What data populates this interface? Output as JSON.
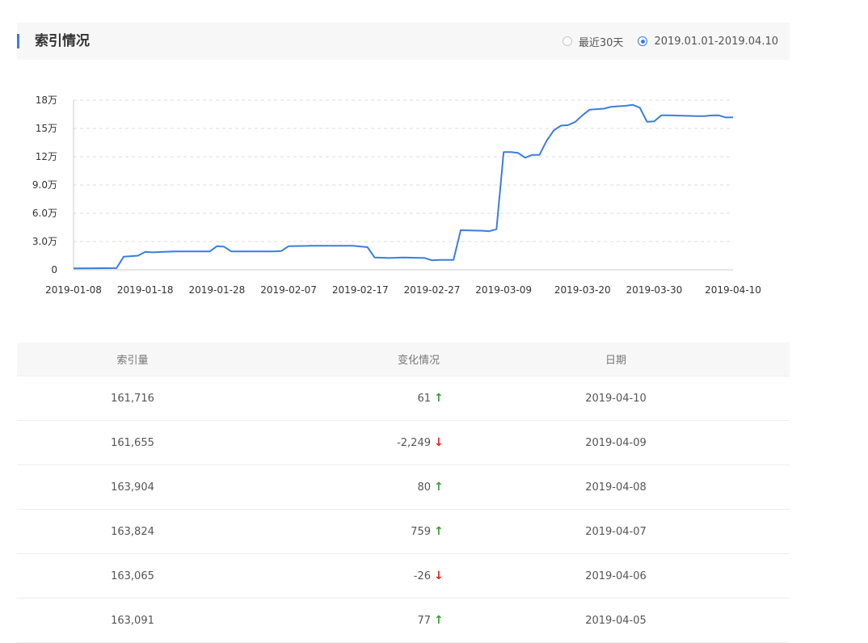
{
  "header": {
    "title": "索引情况",
    "options": [
      {
        "label": "最近30天",
        "selected": false
      },
      {
        "label": "2019.01.01-2019.04.10",
        "selected": true
      }
    ]
  },
  "colors": {
    "line": "#3b7ddd",
    "accent": "#3b7ddd",
    "up": "#3c9a3c",
    "down": "#e02020"
  },
  "chart_data": {
    "type": "line",
    "x_ticks": [
      "2019-01-08",
      "2019-01-18",
      "2019-01-28",
      "2019-02-07",
      "2019-02-17",
      "2019-02-27",
      "2019-03-09",
      "2019-03-20",
      "2019-03-30",
      "2019-04-10"
    ],
    "y_ticks": [
      "0",
      "3.0万",
      "6.0万",
      "9.0万",
      "12万",
      "15万",
      "18万"
    ],
    "ylim": [
      0,
      180000
    ],
    "xlim": [
      "2019-01-08",
      "2019-04-10"
    ],
    "grid": true,
    "points": [
      [
        "2019-01-08",
        1500
      ],
      [
        "2019-01-14",
        1800
      ],
      [
        "2019-01-15",
        14000
      ],
      [
        "2019-01-16",
        14500
      ],
      [
        "2019-01-17",
        15000
      ],
      [
        "2019-01-18",
        19000
      ],
      [
        "2019-01-19",
        18500
      ],
      [
        "2019-01-22",
        19500
      ],
      [
        "2019-01-24",
        19500
      ],
      [
        "2019-01-27",
        19500
      ],
      [
        "2019-01-28",
        25000
      ],
      [
        "2019-01-29",
        24500
      ],
      [
        "2019-01-30",
        19500
      ],
      [
        "2019-02-05",
        19500
      ],
      [
        "2019-02-06",
        20000
      ],
      [
        "2019-02-07",
        25000
      ],
      [
        "2019-02-10",
        25500
      ],
      [
        "2019-02-16",
        25500
      ],
      [
        "2019-02-18",
        24000
      ],
      [
        "2019-02-19",
        13000
      ],
      [
        "2019-02-21",
        12500
      ],
      [
        "2019-02-23",
        13000
      ],
      [
        "2019-02-26",
        12500
      ],
      [
        "2019-02-27",
        10000
      ],
      [
        "2019-02-28",
        10500
      ],
      [
        "2019-03-02",
        10500
      ],
      [
        "2019-03-03",
        42000
      ],
      [
        "2019-03-06",
        41500
      ],
      [
        "2019-03-07",
        41000
      ],
      [
        "2019-03-08",
        43000
      ],
      [
        "2019-03-09",
        125000
      ],
      [
        "2019-03-10",
        125000
      ],
      [
        "2019-03-11",
        124000
      ],
      [
        "2019-03-12",
        119000
      ],
      [
        "2019-03-13",
        122000
      ],
      [
        "2019-03-14",
        122000
      ],
      [
        "2019-03-15",
        137000
      ],
      [
        "2019-03-16",
        148000
      ],
      [
        "2019-03-17",
        153000
      ],
      [
        "2019-03-18",
        153500
      ],
      [
        "2019-03-19",
        157000
      ],
      [
        "2019-03-20",
        164000
      ],
      [
        "2019-03-21",
        170000
      ],
      [
        "2019-03-23",
        171000
      ],
      [
        "2019-03-24",
        173000
      ],
      [
        "2019-03-26",
        174000
      ],
      [
        "2019-03-27",
        175000
      ],
      [
        "2019-03-28",
        172000
      ],
      [
        "2019-03-29",
        157000
      ],
      [
        "2019-03-30",
        157500
      ],
      [
        "2019-03-31",
        164000
      ],
      [
        "2019-04-01",
        164000
      ],
      [
        "2019-04-03",
        163500
      ],
      [
        "2019-04-05",
        163091
      ],
      [
        "2019-04-06",
        163065
      ],
      [
        "2019-04-07",
        163824
      ],
      [
        "2019-04-08",
        163904
      ],
      [
        "2019-04-09",
        161655
      ],
      [
        "2019-04-10",
        161716
      ]
    ]
  },
  "table": {
    "headers": [
      "索引量",
      "变化情况",
      "日期"
    ],
    "rows": [
      {
        "count": "161,716",
        "change": "61",
        "direction": "up",
        "date": "2019-04-10"
      },
      {
        "count": "161,655",
        "change": "-2,249",
        "direction": "down",
        "date": "2019-04-09"
      },
      {
        "count": "163,904",
        "change": "80",
        "direction": "up",
        "date": "2019-04-08"
      },
      {
        "count": "163,824",
        "change": "759",
        "direction": "up",
        "date": "2019-04-07"
      },
      {
        "count": "163,065",
        "change": "-26",
        "direction": "down",
        "date": "2019-04-06"
      },
      {
        "count": "163,091",
        "change": "77",
        "direction": "up",
        "date": "2019-04-05"
      }
    ]
  }
}
